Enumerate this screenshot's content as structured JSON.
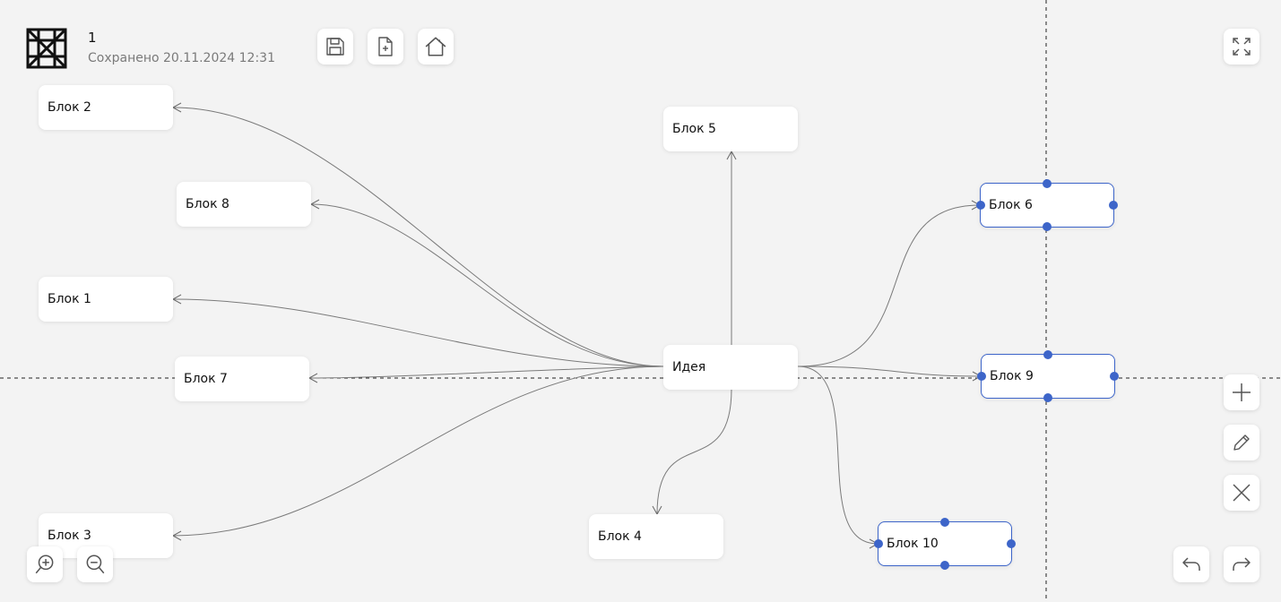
{
  "header": {
    "title": "1",
    "saved_label": "Сохранено 20.11.2024 12:31"
  },
  "toolbar": {
    "save_icon": "save-icon",
    "new_file_icon": "file-plus-icon",
    "home_icon": "home-icon",
    "fullscreen_icon": "fullscreen-icon"
  },
  "side_tools": {
    "add_icon": "plus-icon",
    "edit_icon": "pencil-icon",
    "delete_icon": "close-icon"
  },
  "zoom": {
    "zoom_in_icon": "zoom-in-icon",
    "zoom_out_icon": "zoom-out-icon"
  },
  "history": {
    "undo_icon": "undo-icon",
    "redo_icon": "redo-icon"
  },
  "nodes": {
    "idea": "Идея",
    "b1": "Блок 1",
    "b2": "Блок 2",
    "b3": "Блок 3",
    "b4": "Блок 4",
    "b5": "Блок 5",
    "b6": "Блок 6",
    "b7": "Блок 7",
    "b8": "Блок 8",
    "b9": "Блок 9",
    "b10": "Блок 10"
  },
  "colors": {
    "background": "#f3f3f3",
    "selection": "#3d65c9",
    "edge": "#7a7a7a",
    "guide": "#222222"
  }
}
